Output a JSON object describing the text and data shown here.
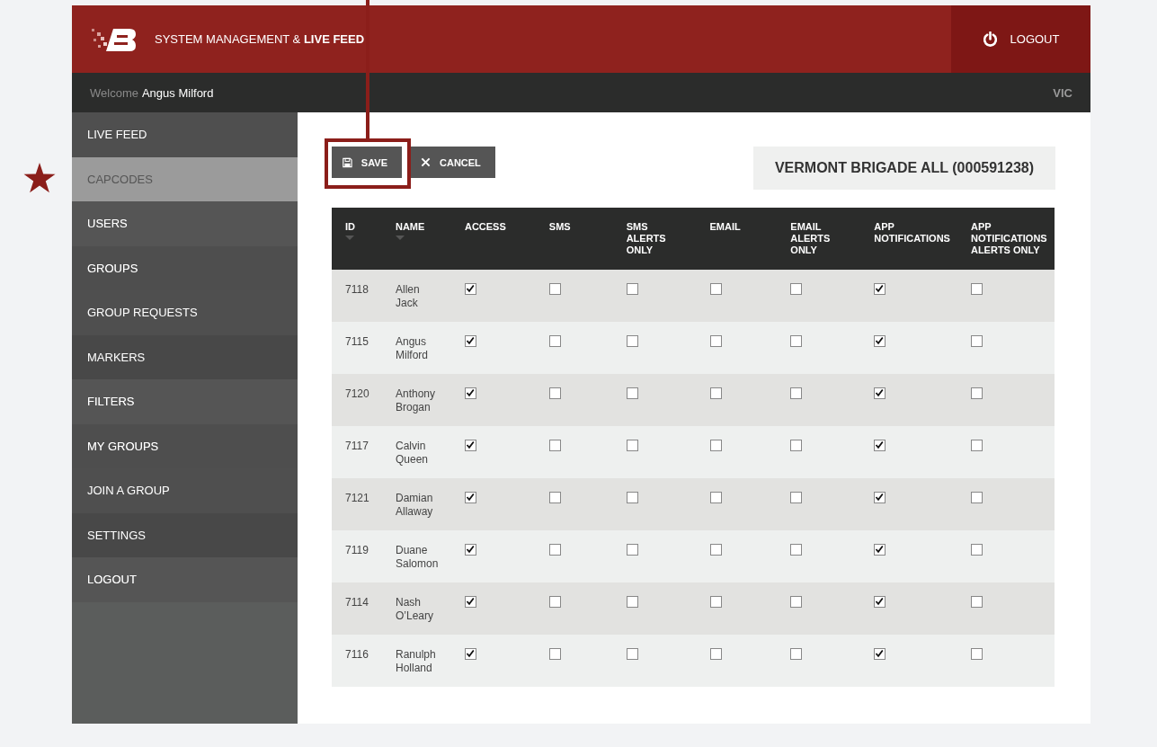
{
  "header": {
    "title": "SYSTEM MANAGEMENT & **LIVE FEED**",
    "logout": "LOGOUT"
  },
  "user_bar": {
    "welcome": "Welcome",
    "user": "Angus Milford",
    "region": "VIC"
  },
  "sidebar": {
    "items": [
      {
        "label": "LIVE FEED",
        "selected": false
      },
      {
        "label": "CAPCODES",
        "selected": true
      },
      {
        "label": "USERS",
        "selected": false
      },
      {
        "label": "GROUPS",
        "selected": false
      },
      {
        "label": "GROUP REQUESTS",
        "selected": false
      },
      {
        "label": "MARKERS",
        "selected": false
      },
      {
        "label": "FILTERS",
        "selected": false
      },
      {
        "label": "MY GROUPS",
        "selected": false
      },
      {
        "label": "JOIN A GROUP",
        "selected": false
      },
      {
        "label": "SETTINGS",
        "selected": false
      },
      {
        "label": "LOGOUT",
        "selected": false
      }
    ]
  },
  "toolbar": {
    "save": "SAVE",
    "cancel": "CANCEL"
  },
  "capcode_title": "VERMONT BRIGADE ALL (000591238)",
  "table": {
    "columns": [
      {
        "label": "ID",
        "sortable": true
      },
      {
        "label": "NAME",
        "sortable": true
      },
      {
        "label": "ACCESS",
        "sortable": false
      },
      {
        "label": "SMS",
        "sortable": false
      },
      {
        "label": "SMS ALERTS ONLY",
        "sortable": false
      },
      {
        "label": "EMAIL",
        "sortable": false
      },
      {
        "label": "EMAIL ALERTS ONLY",
        "sortable": false
      },
      {
        "label": "APP NOTIFICATIONS",
        "sortable": false
      },
      {
        "label": "APP NOTIFICATIONS ALERTS ONLY",
        "sortable": false
      }
    ],
    "rows": [
      {
        "id": "7118",
        "name": "Allen Jack",
        "checks": [
          true,
          false,
          false,
          false,
          false,
          true,
          false
        ]
      },
      {
        "id": "7115",
        "name": "Angus Milford",
        "checks": [
          true,
          false,
          false,
          false,
          false,
          true,
          false
        ]
      },
      {
        "id": "7120",
        "name": "Anthony Brogan",
        "checks": [
          true,
          false,
          false,
          false,
          false,
          true,
          false
        ]
      },
      {
        "id": "7117",
        "name": "Calvin Queen",
        "checks": [
          true,
          false,
          false,
          false,
          false,
          true,
          false
        ]
      },
      {
        "id": "7121",
        "name": "Damian Allaway",
        "checks": [
          true,
          false,
          false,
          false,
          false,
          true,
          false
        ]
      },
      {
        "id": "7119",
        "name": "Duane Salomon",
        "checks": [
          true,
          false,
          false,
          false,
          false,
          true,
          false
        ]
      },
      {
        "id": "7114",
        "name": "Nash O’Leary",
        "checks": [
          true,
          false,
          false,
          false,
          false,
          true,
          false
        ]
      },
      {
        "id": "7116",
        "name": "Ranulph Holland",
        "checks": [
          true,
          false,
          false,
          false,
          false,
          true,
          false
        ]
      }
    ]
  }
}
